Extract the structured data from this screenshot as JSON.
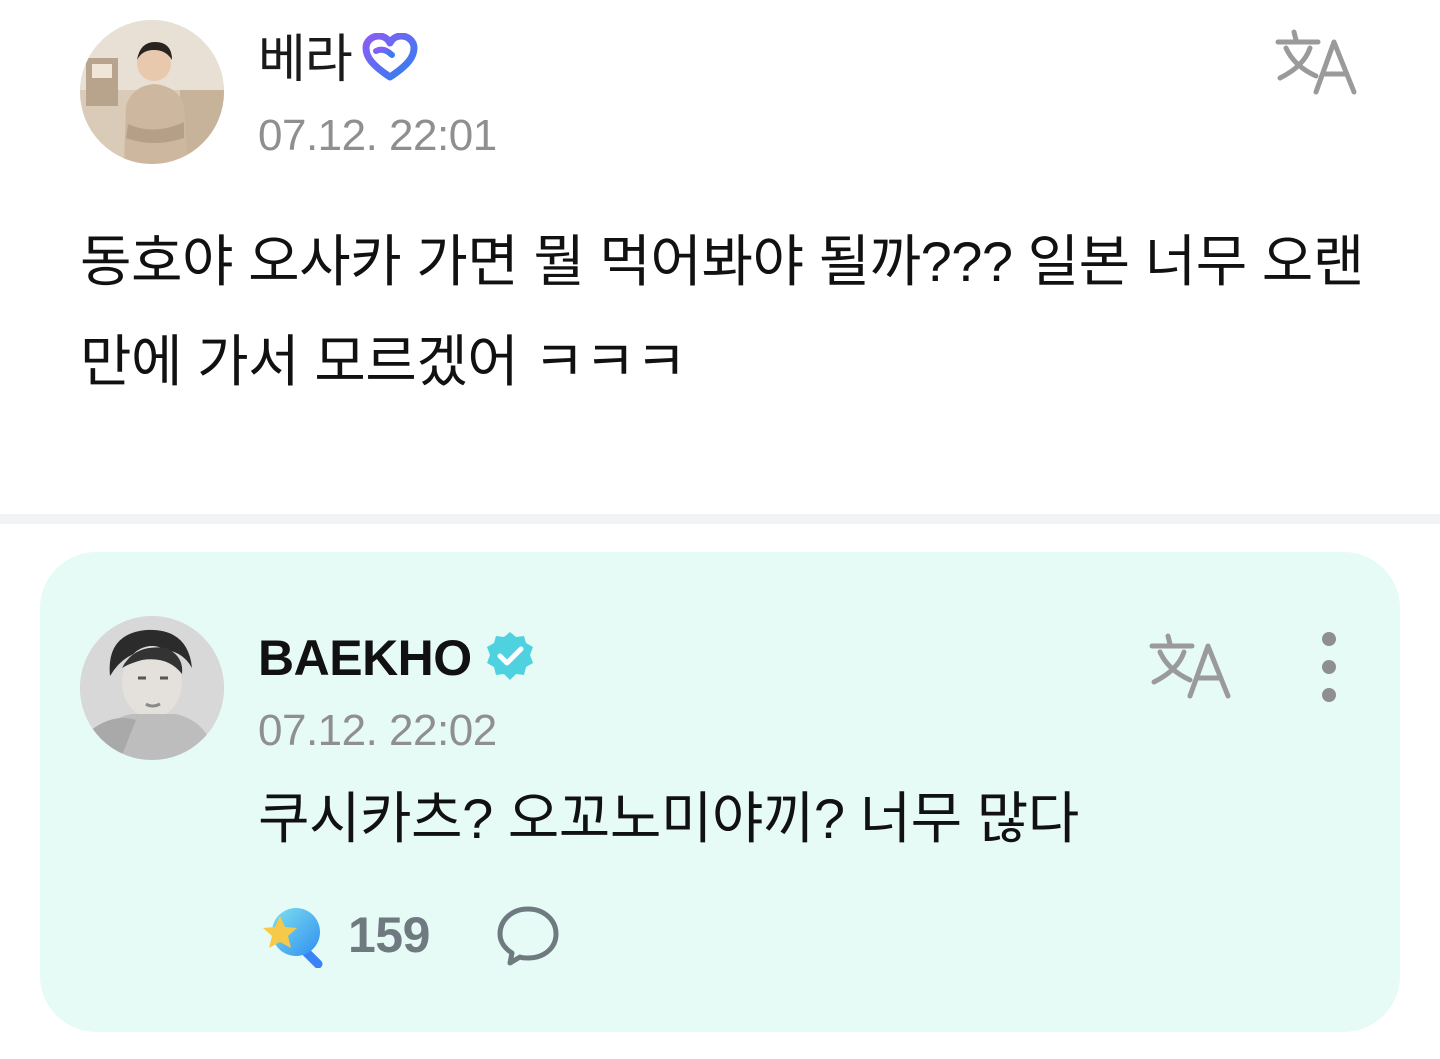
{
  "fan_post": {
    "username": "베라",
    "timestamp": "07.12. 22:01",
    "body": "동호야 오사카 가면 뭘 먹어봐야 될까??? 일본 너무 오랜만에 가서 모르겠어 ㅋㅋㅋ",
    "badge_icon": "heart-badge-icon",
    "translate_icon": "translate-icon"
  },
  "artist_reply": {
    "username": "BAEKHO",
    "timestamp": "07.12. 22:02",
    "body": "쿠시카츠? 오꼬노미야끼? 너무 많다",
    "badge_icon": "verified-badge-icon",
    "reaction_count": "159",
    "reaction_icon": "star-wand-icon",
    "comment_icon": "speech-bubble-icon",
    "more_icon": "more-vertical-icon"
  },
  "colors": {
    "reply_card_bg": "#e6fbf6",
    "verified_badge": "#4fd2e0",
    "timestamp_text": "#8f8f8f",
    "reaction_count_text": "#6e7a80"
  }
}
